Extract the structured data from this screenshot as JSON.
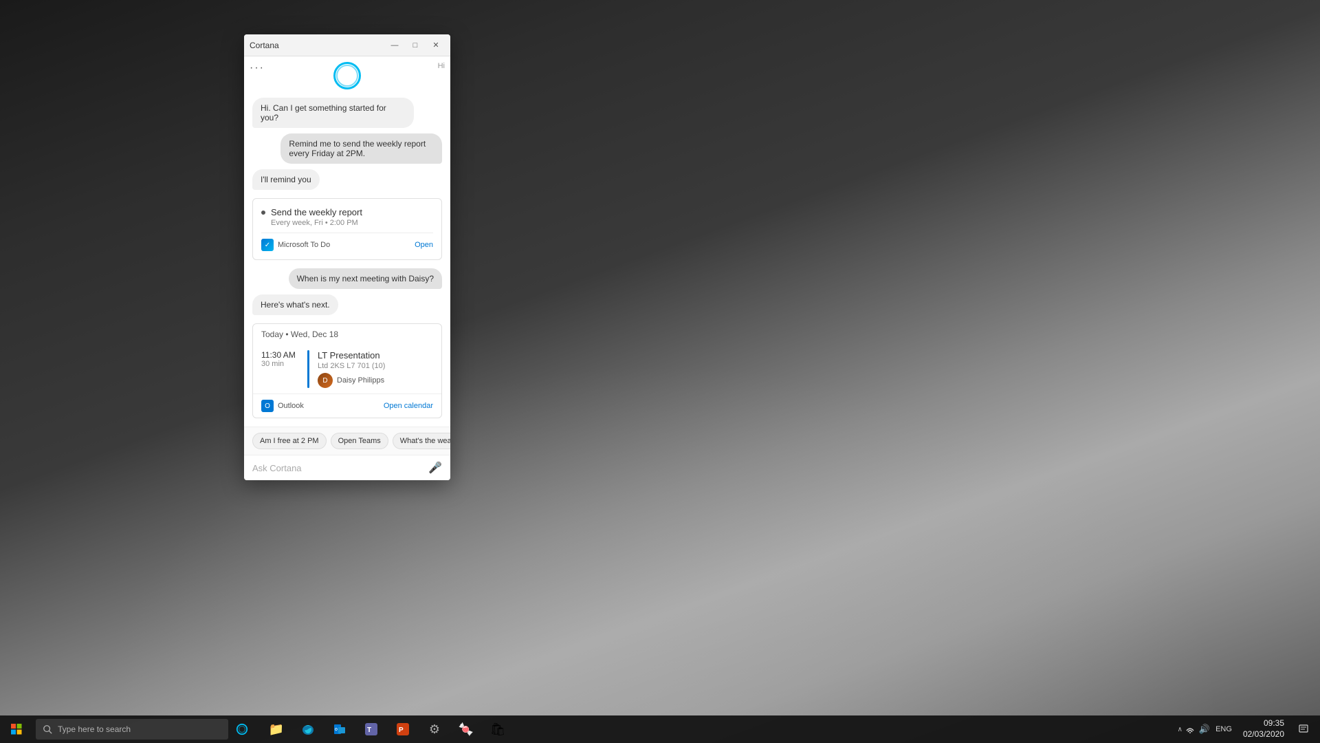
{
  "desktop": {
    "background": "mountain-bw"
  },
  "cortana": {
    "title": "Cortana",
    "menu_dots": "···",
    "hi_label": "Hi",
    "greeting": "Hi. Can I get something started for you?",
    "user_msg1": "Remind me to send the weekly report every Friday at 2PM.",
    "cortana_reply1": "I'll remind you",
    "reminder": {
      "task": "Send the weekly report",
      "schedule": "Every week, Fri • 2:00 PM",
      "app": "Microsoft To Do",
      "open_link": "Open"
    },
    "user_msg2": "When is my next meeting with Daisy?",
    "cortana_reply2": "Here's what's next.",
    "calendar": {
      "date_label": "Today • Wed, Dec 18",
      "time": "11:30 AM",
      "duration": "30 min",
      "event_title": "LT Presentation",
      "event_location": "Ltd 2KS L7 701 (10)",
      "attendee": "Daisy Philipps",
      "app": "Outlook",
      "open_cal_link": "Open calendar"
    },
    "suggestions": [
      "Am I free at 2 PM",
      "Open Teams",
      "What's the weath..."
    ],
    "input_placeholder": "Ask Cortana"
  },
  "taskbar": {
    "search_placeholder": "Type here to search",
    "apps": [
      {
        "name": "File Explorer",
        "icon": "📁"
      },
      {
        "name": "Microsoft Edge",
        "icon": "🌐"
      },
      {
        "name": "Outlook Mail",
        "icon": "✉"
      },
      {
        "name": "Microsoft Teams",
        "icon": "T"
      },
      {
        "name": "PowerPoint",
        "icon": "P"
      },
      {
        "name": "Settings",
        "icon": "⚙"
      },
      {
        "name": "Candy Crush",
        "icon": "🍬"
      },
      {
        "name": "Microsoft Store",
        "icon": "🛍"
      }
    ],
    "tray": {
      "language": "ENG",
      "time": "09:35",
      "date": "02/03/2020"
    }
  },
  "window_controls": {
    "minimize": "—",
    "maximize": "□",
    "close": "✕"
  }
}
